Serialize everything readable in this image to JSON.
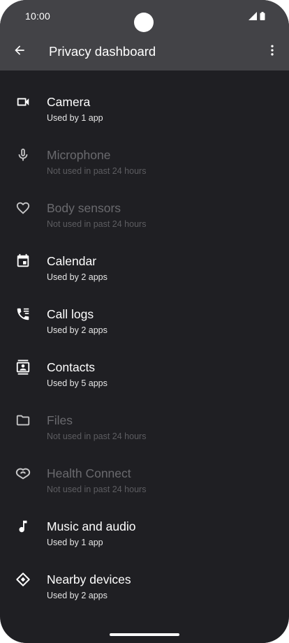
{
  "status_bar": {
    "time": "10:00",
    "icons": [
      "signal-icon",
      "battery-icon"
    ]
  },
  "app_bar": {
    "title": "Privacy dashboard",
    "back_icon": "arrow-back-icon",
    "more_icon": "more-vert-icon"
  },
  "items": [
    {
      "title": "Camera",
      "subtitle": "Used by 1 app",
      "icon": "videocam-icon",
      "enabled": true
    },
    {
      "title": "Microphone",
      "subtitle": "Not used in past 24 hours",
      "icon": "mic-icon",
      "enabled": false
    },
    {
      "title": "Body sensors",
      "subtitle": "Not used in past 24 hours",
      "icon": "heart-icon",
      "enabled": false
    },
    {
      "title": "Calendar",
      "subtitle": "Used by 2 apps",
      "icon": "calendar-icon",
      "enabled": true
    },
    {
      "title": "Call logs",
      "subtitle": "Used by 2 apps",
      "icon": "call-log-icon",
      "enabled": true
    },
    {
      "title": "Contacts",
      "subtitle": "Used by 5 apps",
      "icon": "contacts-icon",
      "enabled": true
    },
    {
      "title": "Files",
      "subtitle": "Not used in past 24 hours",
      "icon": "folder-icon",
      "enabled": false
    },
    {
      "title": "Health Connect",
      "subtitle": "Not used in past 24 hours",
      "icon": "health-connect-icon",
      "enabled": false
    },
    {
      "title": "Music and audio",
      "subtitle": "Used by 1 app",
      "icon": "music-note-icon",
      "enabled": true
    },
    {
      "title": "Nearby devices",
      "subtitle": "Used by 2 apps",
      "icon": "nearby-devices-icon",
      "enabled": true
    }
  ],
  "colors": {
    "background": "#1f1f23",
    "bar": "#434347",
    "text_primary": "#ffffff",
    "text_disabled": "#6a6a6e"
  }
}
